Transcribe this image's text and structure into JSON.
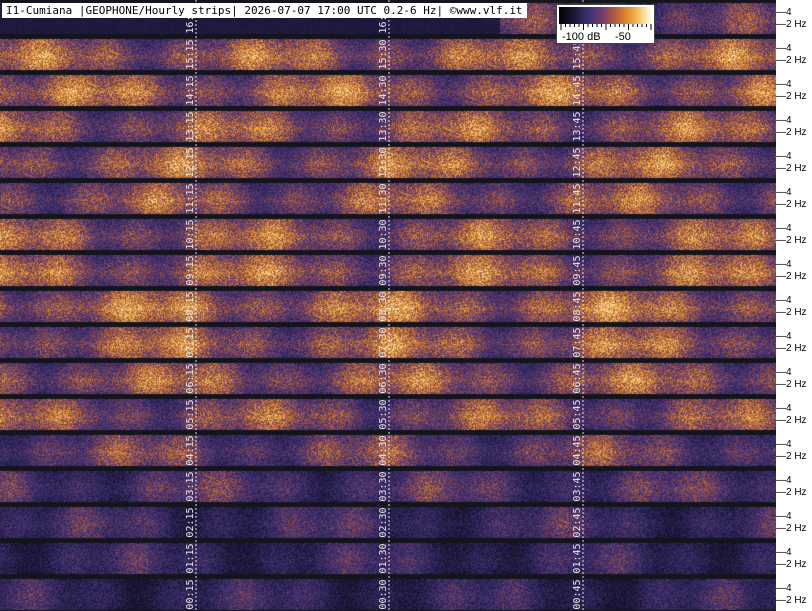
{
  "title": "I1-Cumiana |GEOPHONE/Hourly strips| 2026-07-07 17:00 UTC 0.2-6 Hz| ©www.vlf.it",
  "colorbar": {
    "labels": [
      "-100 dB",
      "-50"
    ]
  },
  "chart_data": {
    "type": "heatmap",
    "title": "I1-Cumiana |GEOPHONE/Hourly strips| 2026-07-07 17:00 UTC 0.2-6 Hz| ©www.vlf.it",
    "colorbar_labels": [
      "-100 dB",
      "-50"
    ],
    "y_tick_labels": [
      "4",
      "2 Hz"
    ],
    "strips": [
      {
        "times": [
          "16:15",
          "16:30",
          "16:45"
        ],
        "intensity": 0.45,
        "partial": true
      },
      {
        "times": [
          "15:15",
          "15:30",
          "15:45"
        ],
        "intensity": 0.62
      },
      {
        "times": [
          "14:15",
          "14:30",
          "14:45"
        ],
        "intensity": 0.64
      },
      {
        "times": [
          "13:15",
          "13:30",
          "13:45"
        ],
        "intensity": 0.6
      },
      {
        "times": [
          "12:15",
          "12:30",
          "12:45"
        ],
        "intensity": 0.62
      },
      {
        "times": [
          "11:15",
          "11:30",
          "11:45"
        ],
        "intensity": 0.58
      },
      {
        "times": [
          "10:15",
          "10:30",
          "10:45"
        ],
        "intensity": 0.6
      },
      {
        "times": [
          "09:15",
          "09:30",
          "09:45"
        ],
        "intensity": 0.62
      },
      {
        "times": [
          "08:15",
          "08:30",
          "08:45"
        ],
        "intensity": 0.66
      },
      {
        "times": [
          "07:15",
          "07:30",
          "07:45"
        ],
        "intensity": 0.62
      },
      {
        "times": [
          "06:15",
          "06:30",
          "06:45"
        ],
        "intensity": 0.6
      },
      {
        "times": [
          "05:15",
          "05:30",
          "05:45"
        ],
        "intensity": 0.56
      },
      {
        "times": [
          "04:15",
          "04:30",
          "04:45"
        ],
        "intensity": 0.5
      },
      {
        "times": [
          "03:15",
          "03:30",
          "03:45"
        ],
        "intensity": 0.4
      },
      {
        "times": [
          "02:15",
          "02:30",
          "02:45"
        ],
        "intensity": 0.32
      },
      {
        "times": [
          "01:15",
          "01:30",
          "01:45"
        ],
        "intensity": 0.28
      },
      {
        "times": [
          "00:15",
          "00:30",
          "00:45"
        ],
        "intensity": 0.26
      }
    ]
  }
}
